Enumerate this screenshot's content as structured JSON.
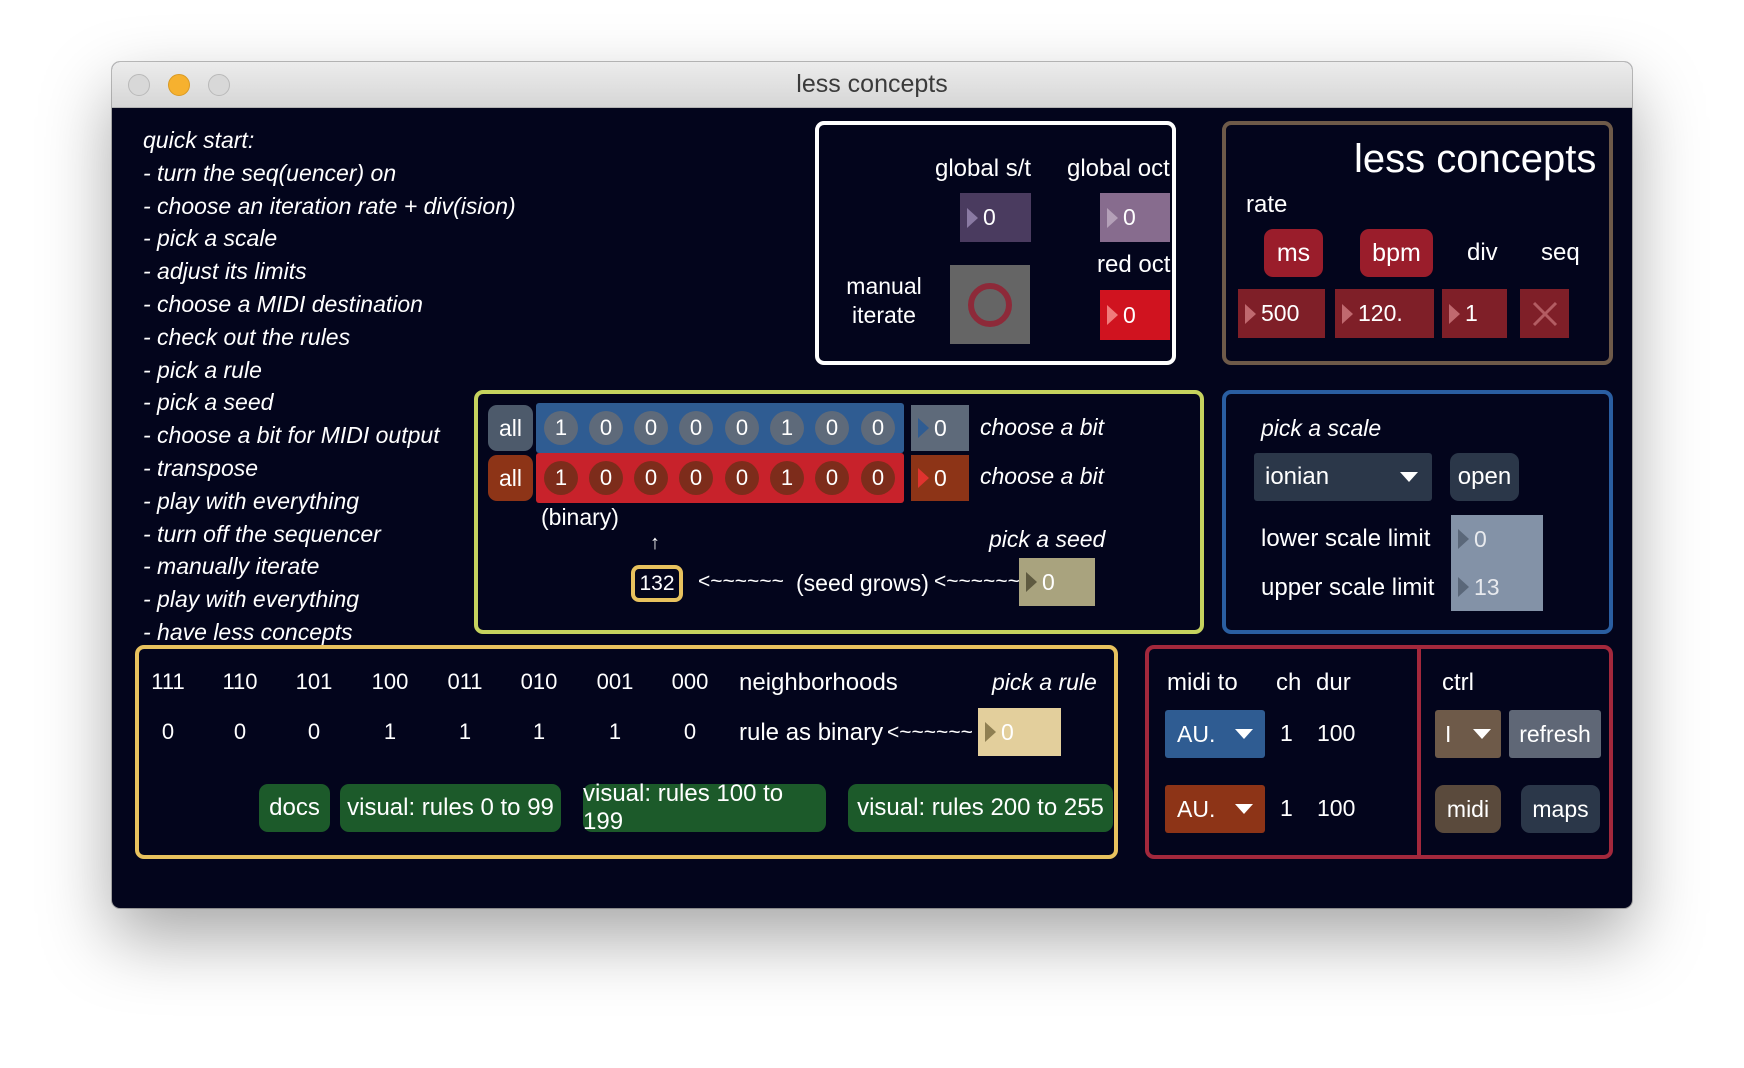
{
  "window": {
    "title": "less concepts"
  },
  "quick_start": {
    "heading": "quick start:",
    "items": [
      "- turn the seq(uencer) on",
      "- choose an iteration rate + div(ision)",
      "- pick a scale",
      "- adjust its limits",
      "- choose a MIDI destination",
      "- check out the rules",
      "- pick a rule",
      "- pick a seed",
      "- choose a bit for MIDI output",
      "- transpose",
      "- play with everything",
      "- turn off the sequencer",
      "- manually iterate",
      "- play with everything",
      "- have less concepts"
    ]
  },
  "global": {
    "st_label": "global s/t",
    "st_value": "0",
    "oct_label": "global oct",
    "oct_value": "0",
    "manual_label_1": "manual",
    "manual_label_2": "iterate",
    "red_oct_label": "red oct",
    "red_oct_value": "0"
  },
  "brand": {
    "title": "less concepts",
    "rate_label": "rate",
    "ms_label": "ms",
    "bpm_label": "bpm",
    "div_label": "div",
    "seq_label": "seq",
    "ms_value": "500",
    "bpm_value": "120.",
    "div_value": "1"
  },
  "bits": {
    "all_label": "all",
    "blue_bits": [
      "1",
      "0",
      "0",
      "0",
      "0",
      "1",
      "0",
      "0"
    ],
    "red_bits": [
      "1",
      "0",
      "0",
      "0",
      "0",
      "1",
      "0",
      "0"
    ],
    "blue_choice": "0",
    "red_choice": "0",
    "choose_label": "choose a bit",
    "binary_label": "(binary)",
    "arrow_up": "↑",
    "seed_label": "pick a seed",
    "seed_display": "132",
    "arrow_left": "<~~~~~~",
    "seed_grows": "(seed grows)",
    "seed_value": "0"
  },
  "scale": {
    "label": "pick a scale",
    "selected": "ionian",
    "open_label": "open",
    "lower_label": "lower scale limit",
    "lower_value": "0",
    "upper_label": "upper scale limit",
    "upper_value": "13"
  },
  "rules": {
    "neighborhoods": [
      "111",
      "110",
      "101",
      "100",
      "011",
      "010",
      "001",
      "000"
    ],
    "binary": [
      "0",
      "0",
      "0",
      "1",
      "1",
      "1",
      "1",
      "0"
    ],
    "neighborhoods_label": "neighborhoods",
    "pick_rule_label": "pick a rule",
    "rule_binary_label": "rule as binary",
    "arrow_left": "<~~~~~~",
    "rule_value": "0",
    "docs_label": "docs",
    "visual_1": "visual: rules 0 to 99",
    "visual_2": "visual: rules 100 to 199",
    "visual_3": "visual: rules 200 to 255"
  },
  "midi": {
    "midi_to_label": "midi to",
    "ch_label": "ch",
    "dur_label": "dur",
    "row1_dest": "AU.",
    "row1_ch": "1",
    "row1_dur": "100",
    "row2_dest": "AU.",
    "row2_ch": "1",
    "row2_dur": "100"
  },
  "ctrl": {
    "label": "ctrl",
    "dropdown": "I",
    "refresh_label": "refresh",
    "midi_label": "midi",
    "maps_label": "maps"
  },
  "colors": {
    "background": "#03051c",
    "blue": "#2f5c92",
    "red": "#c8222b",
    "green_button": "#1c5a2a",
    "yellow_border": "#e8c25e",
    "green_border": "#c6d35e"
  }
}
